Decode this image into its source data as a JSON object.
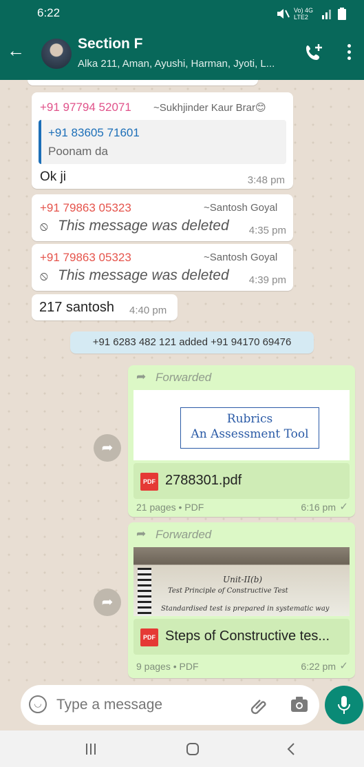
{
  "status": {
    "time": "6:22",
    "network": "Vo) 4G LTE2"
  },
  "header": {
    "title": "Section F",
    "subtitle": "Alka 211, Aman, Ayushi, Harman, Jyoti, L..."
  },
  "messages": [
    {
      "sender": "+91 97794 52071",
      "sender_name": "~Sukhjinder Kaur Brar😊",
      "quote_sender": "+91 83605 71601",
      "quote_text": "Poonam da",
      "text": "Ok ji",
      "time": "3:48 pm"
    },
    {
      "sender": "+91 79863 05323",
      "sender_name": "~Santosh Goyal",
      "text": "This message was deleted",
      "time": "4:35 pm"
    },
    {
      "sender": "+91 79863 05323",
      "sender_name": "~Santosh Goyal",
      "text": "This message was deleted",
      "time": "4:39 pm"
    },
    {
      "text": "217 santosh",
      "time": "4:40 pm"
    }
  ],
  "system_message": "+91 6283 482 121 added +91 94170 69476",
  "doc1": {
    "forwarded": "Forwarded",
    "preview_line1": "Rubrics",
    "preview_line2": "An Assessment Tool",
    "pdf_label": "PDF",
    "filename": "2788301.pdf",
    "info": "21 pages • PDF",
    "time": "6:16 pm"
  },
  "doc2": {
    "forwarded": "Forwarded",
    "preview_heading": "Unit-II(b)",
    "preview_line1": "Test Principle of Constructive Test",
    "preview_line2": "Standardised test is prepared in systematic way",
    "pdf_label": "PDF",
    "filename": "Steps of Constructive tes...",
    "info": "9 pages • PDF",
    "time": "6:22 pm"
  },
  "input": {
    "placeholder": "Type a message"
  },
  "colors": {
    "header": "#08685a",
    "sender_pink": "#e0528a",
    "sender_red": "#e5534b",
    "link_blue": "#1c6fb8"
  }
}
